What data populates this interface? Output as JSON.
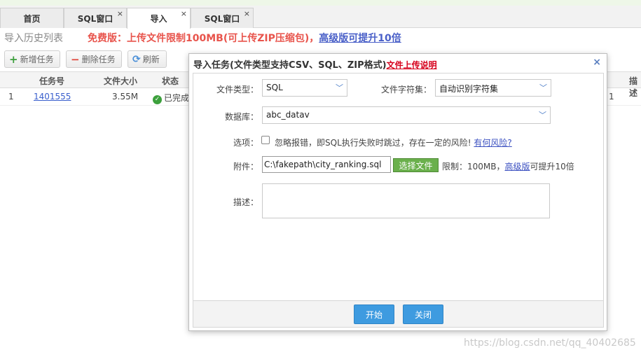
{
  "tabs": [
    {
      "label": "首页"
    },
    {
      "label": "SQL窗口"
    },
    {
      "label": "导入"
    },
    {
      "label": "SQL窗口"
    }
  ],
  "close_glyph": "×",
  "history": {
    "title": "导入历史列表",
    "promo_text": "免费版：上传文件限制100MB(可上传ZIP压缩包)，",
    "promo_link": "高级版可提升10倍"
  },
  "toolbar": {
    "add_label": "新增任务",
    "delete_label": "删除任务",
    "refresh_label": "刷新"
  },
  "grid": {
    "headers": [
      "任务号",
      "文件大小",
      "状态",
      "描述"
    ],
    "row": {
      "index": "1",
      "task_id": "1401555",
      "size": "3.55M",
      "status": "已完成",
      "right_fragment": "1"
    }
  },
  "dialog": {
    "title": "导入任务(文件类型支持CSV、SQL、ZIP格式)",
    "title_link": "文件上传说明",
    "close": "×",
    "file_type_label": "文件类型：",
    "file_type_value": "SQL",
    "charset_label": "文件字符集：",
    "charset_value": "自动识别字符集",
    "database_label": "数据库：",
    "database_value": "abc_datav",
    "options_label": "选项：",
    "options_text": "忽略报错，即SQL执行失败时跳过，存在一定的风险!",
    "options_link": "有何风险?",
    "attachment_label": "附件：",
    "attachment_value": "C:\\fakepath\\city_ranking.sql",
    "choose_file": "选择文件",
    "limit_prefix": "限制：100MB，",
    "limit_link": "高级版",
    "limit_suffix": "可提升10倍",
    "description_label": "描述：",
    "start_button": "开始",
    "close_button": "关闭"
  },
  "watermark": "https://blog.csdn.net/qq_40402685",
  "colors": {
    "promo_red": "#e8544c",
    "primary_blue": "#3e9be0",
    "choose_green": "#6ab04c",
    "link_red": "#d6001c"
  }
}
